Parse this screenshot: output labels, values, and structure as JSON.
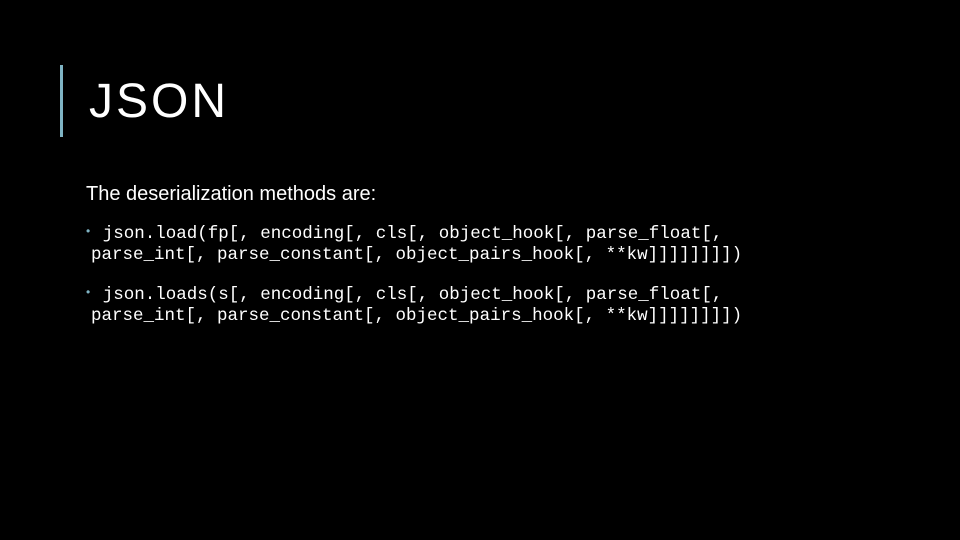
{
  "slide": {
    "title": "JSON",
    "intro": "The deserialization methods are:",
    "accent_color": "#7fb4c4",
    "items": [
      {
        "bullet": "•",
        "line1": "json.load(fp[, encoding[, cls[, object_hook[, parse_float[,",
        "line2": "parse_int[, parse_constant[, object_pairs_hook[, **kw]]]]]]]])"
      },
      {
        "bullet": "•",
        "line1": "json.loads(s[, encoding[, cls[, object_hook[, parse_float[,",
        "line2": "parse_int[, parse_constant[, object_pairs_hook[, **kw]]]]]]]])"
      }
    ]
  }
}
